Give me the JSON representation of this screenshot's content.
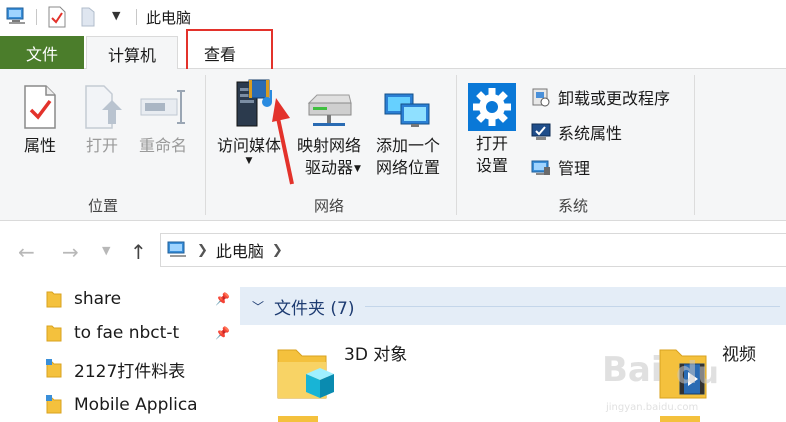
{
  "window": {
    "title": "此电脑"
  },
  "tabs": {
    "file": "文件",
    "computer": "计算机",
    "view": "查看"
  },
  "ribbon": {
    "location_group": {
      "label": "位置",
      "properties": "属性",
      "open": "打开",
      "rename": "重命名"
    },
    "network_group": {
      "label": "网络",
      "access_media_line1": "访问媒体",
      "map_drive_line1": "映射网络",
      "map_drive_line2": "驱动器",
      "add_location_line1": "添加一个",
      "add_location_line2": "网络位置"
    },
    "system_group": {
      "label": "系统",
      "open_settings_line1": "打开",
      "open_settings_line2": "设置",
      "uninstall": "卸载或更改程序",
      "system_properties": "系统属性",
      "manage": "管理"
    }
  },
  "address": {
    "crumb": "此电脑"
  },
  "nav_pane": {
    "items": [
      {
        "label": "share",
        "pinned": true
      },
      {
        "label": "to fae nbct-t",
        "pinned": true
      },
      {
        "label": "2127打件料表",
        "pinned": false
      },
      {
        "label": "Mobile Applica",
        "pinned": false
      }
    ]
  },
  "content": {
    "group_title": "文件夹 (7)",
    "folders": [
      {
        "name": "3D 对象",
        "icon": "3d-objects-folder-icon"
      },
      {
        "name": "视频",
        "icon": "videos-folder-icon"
      }
    ]
  },
  "watermark": {
    "line1": "Bai",
    "line2": "du",
    "line3": "jingyan.baidu.com"
  },
  "colors": {
    "file_tab": "#4b7d2b",
    "highlight": "#e3322b",
    "arrow": "#e3322b",
    "group_header": "#e4edf7"
  }
}
